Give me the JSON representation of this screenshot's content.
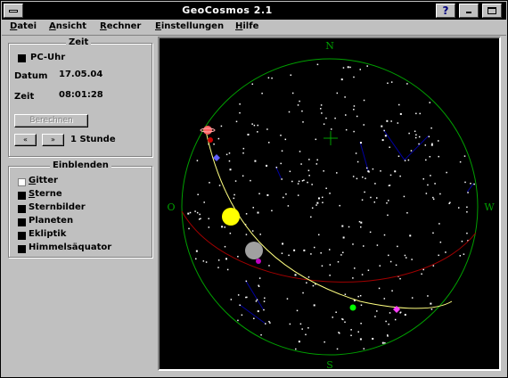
{
  "window": {
    "title": "GeoCosmos 2.1"
  },
  "titlebar": {
    "help": "?"
  },
  "menu": [
    {
      "label_acc": "D",
      "label_rest": "atei"
    },
    {
      "label_acc": "A",
      "label_rest": "nsicht"
    },
    {
      "label_acc": "R",
      "label_rest": "echner"
    },
    {
      "label_acc": "E",
      "label_rest": "instellungen"
    },
    {
      "label_acc": "H",
      "label_rest": "ilfe"
    }
  ],
  "zeit": {
    "group_label": "Zeit",
    "pc_uhr_label": "PC-Uhr",
    "pc_uhr_checked": true,
    "datum_label": "Datum",
    "datum_value": "17.05.04",
    "zeit_label": "Zeit",
    "zeit_value": "08:01:28",
    "berechnen_label": "Berechnen",
    "prev_label": "«",
    "next_label": "»",
    "step_label": "1 Stunde"
  },
  "einblenden": {
    "group_label": "Einblenden",
    "items": [
      {
        "acc": "G",
        "rest": "itter",
        "checked": false
      },
      {
        "acc": "S",
        "rest": "terne",
        "checked": true
      },
      {
        "acc": "",
        "rest": "Sternbilder",
        "checked": true
      },
      {
        "acc": "",
        "rest": "Planeten",
        "checked": true
      },
      {
        "acc": "",
        "rest": "Ekliptik",
        "checked": true
      },
      {
        "acc": "",
        "rest": "Himmelsäquator",
        "checked": true
      }
    ]
  },
  "sky": {
    "compass": {
      "n": "N",
      "s": "S",
      "o": "O",
      "w": "W"
    },
    "colors": {
      "background": "#000000",
      "horizon": "#00a000",
      "ecliptic": "#ffff80",
      "equator": "#a00000",
      "constellation_lines": "#0000a0",
      "stars": "#ffffff",
      "sun": "#ffff00",
      "moon": "#a0a0a0"
    }
  }
}
